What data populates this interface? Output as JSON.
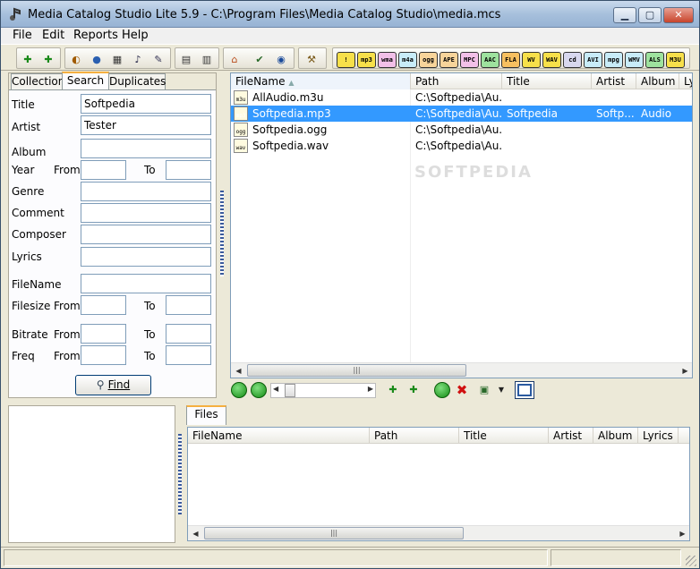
{
  "window": {
    "title": "Media Catalog Studio Lite 5.9 - C:\\Program Files\\Media Catalog Studio\\media.mcs",
    "minimize": "▁",
    "maximize": "▢",
    "close": "✕"
  },
  "menu": [
    "File",
    "Edit",
    "Reports",
    "Help"
  ],
  "formats": [
    {
      "label": "!",
      "color": "#f7e04a"
    },
    {
      "label": "mp3",
      "color": "#f7e04a"
    },
    {
      "label": "wma",
      "color": "#f2c0e8"
    },
    {
      "label": "m4a",
      "color": "#c8ecf8"
    },
    {
      "label": "ogg",
      "color": "#f7d49a"
    },
    {
      "label": "APE",
      "color": "#f7d49a"
    },
    {
      "label": "MPC",
      "color": "#f2c0e8"
    },
    {
      "label": "AAC",
      "color": "#9ee29e"
    },
    {
      "label": "FLA",
      "color": "#f7c060"
    },
    {
      "label": "WV",
      "color": "#f7e04a"
    },
    {
      "label": "WAV",
      "color": "#f7e04a"
    },
    {
      "label": "cd",
      "color": "#d8d8ee"
    },
    {
      "label": "AVI",
      "color": "#c8ecf8"
    },
    {
      "label": "mpg",
      "color": "#c8ecf8"
    },
    {
      "label": "WMV",
      "color": "#c8ecf8"
    },
    {
      "label": "ALS",
      "color": "#9ee29e"
    },
    {
      "label": "M3U",
      "color": "#f7e04a"
    }
  ],
  "tabs": [
    "Collection",
    "Search",
    "Duplicates"
  ],
  "search": {
    "title_label": "Title",
    "title_value": "Softpedia",
    "artist_label": "Artist",
    "artist_value": "Tester",
    "album_label": "Album",
    "year_label": "Year",
    "from": "From",
    "to": "To",
    "genre_label": "Genre",
    "comment_label": "Comment",
    "composer_label": "Composer",
    "lyrics_label": "Lyrics",
    "filename_label": "FileName",
    "filesize_label": "Filesize",
    "bitrate_label": "Bitrate",
    "freq_label": "Freq",
    "find_label": "Find"
  },
  "file_list": {
    "columns": [
      "FileName",
      "Path",
      "Title",
      "Artist",
      "Album",
      "Ly"
    ],
    "rows": [
      {
        "icon": "m3u",
        "name": "AllAudio.m3u",
        "path": "C:\\Softpedia\\Au...",
        "title": "",
        "artist": "",
        "album": "",
        "selected": false
      },
      {
        "icon": "mp3",
        "name": "Softpedia.mp3",
        "path": "C:\\Softpedia\\Au...",
        "title": "Softpedia",
        "artist": "Softp...",
        "album": "Audio",
        "selected": true
      },
      {
        "icon": "ogg",
        "name": "Softpedia.ogg",
        "path": "C:\\Softpedia\\Au...",
        "title": "",
        "artist": "",
        "album": "",
        "selected": false
      },
      {
        "icon": "wav",
        "name": "Softpedia.wav",
        "path": "C:\\Softpedia\\Au...",
        "title": "",
        "artist": "",
        "album": "",
        "selected": false
      }
    ]
  },
  "files_panel": {
    "tab": "Files",
    "columns": [
      "FileName",
      "Path",
      "Title",
      "Artist",
      "Album",
      "Lyrics"
    ]
  },
  "watermark": "SOFTPEDIA"
}
